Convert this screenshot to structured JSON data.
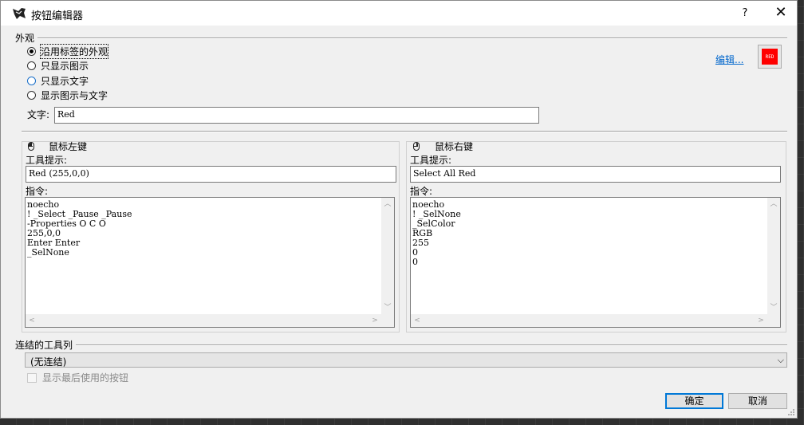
{
  "window": {
    "title": "按钮编辑器",
    "help": "?",
    "close": "✕"
  },
  "appearance": {
    "group_title": "外观",
    "options": [
      {
        "label": "沿用标签的外观",
        "checked": true
      },
      {
        "label": "只显示图示",
        "checked": false
      },
      {
        "label": "只显示文字",
        "checked": false
      },
      {
        "label": "显示图示与文字",
        "checked": false
      }
    ],
    "edit_link": "编辑...",
    "icon_preview_text": "RED",
    "icon_color": "#ff0000",
    "text_label": "文字:",
    "text_value": "Red"
  },
  "left_button": {
    "title": "鼠标左键",
    "tooltip_label": "工具提示:",
    "tooltip_value": "Red (255,0,0)",
    "command_label": "指令:",
    "command": "noecho\n! _Select _Pause _Pause\n-Properties O C O\n255,0,0\nEnter Enter\n_SelNone"
  },
  "right_button": {
    "title": "鼠标右键",
    "tooltip_label": "工具提示:",
    "tooltip_value": "Select All Red",
    "command_label": "指令:",
    "command": "noecho\n! _SelNone\n_SelColor\nRGB\n255\n0\n0"
  },
  "linked_toolbar": {
    "group_title": "连结的工具列",
    "selected": "(无连结)",
    "show_last_used_label": "显示最后使用的按钮"
  },
  "footer": {
    "ok": "确定",
    "cancel": "取消"
  },
  "colors": {
    "accent": "#0078d7",
    "link": "#0066cc"
  }
}
